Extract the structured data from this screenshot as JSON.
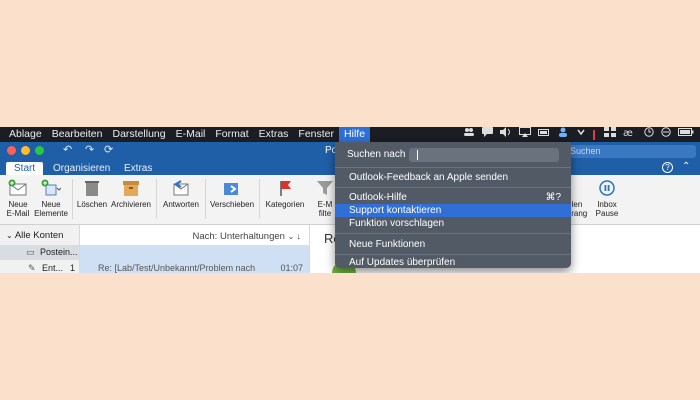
{
  "menubar": {
    "items": [
      "Ablage",
      "Bearbeiten",
      "Darstellung",
      "E-Mail",
      "Format",
      "Extras",
      "Fenster",
      "Hilfe"
    ],
    "active": "Hilfe"
  },
  "window": {
    "title_fragment": "Pos",
    "search_placeholder": "Suchen"
  },
  "tabs": [
    {
      "label": "Start",
      "selected": true
    },
    {
      "label": "Organisieren",
      "selected": false
    },
    {
      "label": "Extras",
      "selected": false
    }
  ],
  "ribbon": {
    "buttons": [
      {
        "label1": "Neue",
        "label2": "E-Mail",
        "icon": "new-email-icon"
      },
      {
        "label1": "Neue",
        "label2": "Elemente",
        "icon": "new-items-icon"
      },
      {
        "label1": "Löschen",
        "label2": "",
        "icon": "trash-icon"
      },
      {
        "label1": "Archivieren",
        "label2": "",
        "icon": "archive-icon"
      },
      {
        "label1": "Antworten",
        "label2": "",
        "icon": "reply-icon"
      },
      {
        "label1": "Verschieben",
        "label2": "",
        "icon": "move-icon"
      },
      {
        "label1": "Kategorien",
        "label2": "",
        "icon": "flag-icon"
      },
      {
        "label1": "E-M",
        "label2": "filte",
        "icon": "filter-icon"
      },
      {
        "label1": "len",
        "label2": "erang",
        "icon": "partial-icon"
      },
      {
        "label1": "Inbox",
        "label2": "Pause",
        "icon": "pause-icon"
      }
    ]
  },
  "sidebar": {
    "header": "Alle Konten",
    "items": [
      {
        "label": "Postein...",
        "count": ""
      },
      {
        "label": "Ent...",
        "count": "1"
      }
    ]
  },
  "message_list": {
    "sort_label": "Nach: Unterhaltungen",
    "first_row_subject": "Re: [Lab/Test/Unbekannt/Problem nach",
    "first_row_time": "01:07"
  },
  "reading_pane": {
    "header": "Re"
  },
  "help_menu": {
    "search_label": "Suchen nach",
    "items": [
      {
        "label": "Outlook-Feedback an Apple senden",
        "shortcut": "",
        "highlighted": false
      },
      {
        "label": "Outlook-Hilfe",
        "shortcut": "⌘?",
        "highlighted": false
      },
      {
        "label": "Support kontaktieren",
        "shortcut": "",
        "highlighted": true
      },
      {
        "label": "Funktion vorschlagen",
        "shortcut": "",
        "highlighted": false
      },
      {
        "label": "Neue Funktionen",
        "shortcut": "",
        "highlighted": false
      },
      {
        "label": "Auf Updates überprüfen",
        "shortcut": "",
        "highlighted": false
      }
    ]
  },
  "colors": {
    "background": "#fbe0cb",
    "outlook_blue": "#1f5fa8",
    "menu_bg": "#525a66",
    "highlight": "#2f6fd6"
  }
}
